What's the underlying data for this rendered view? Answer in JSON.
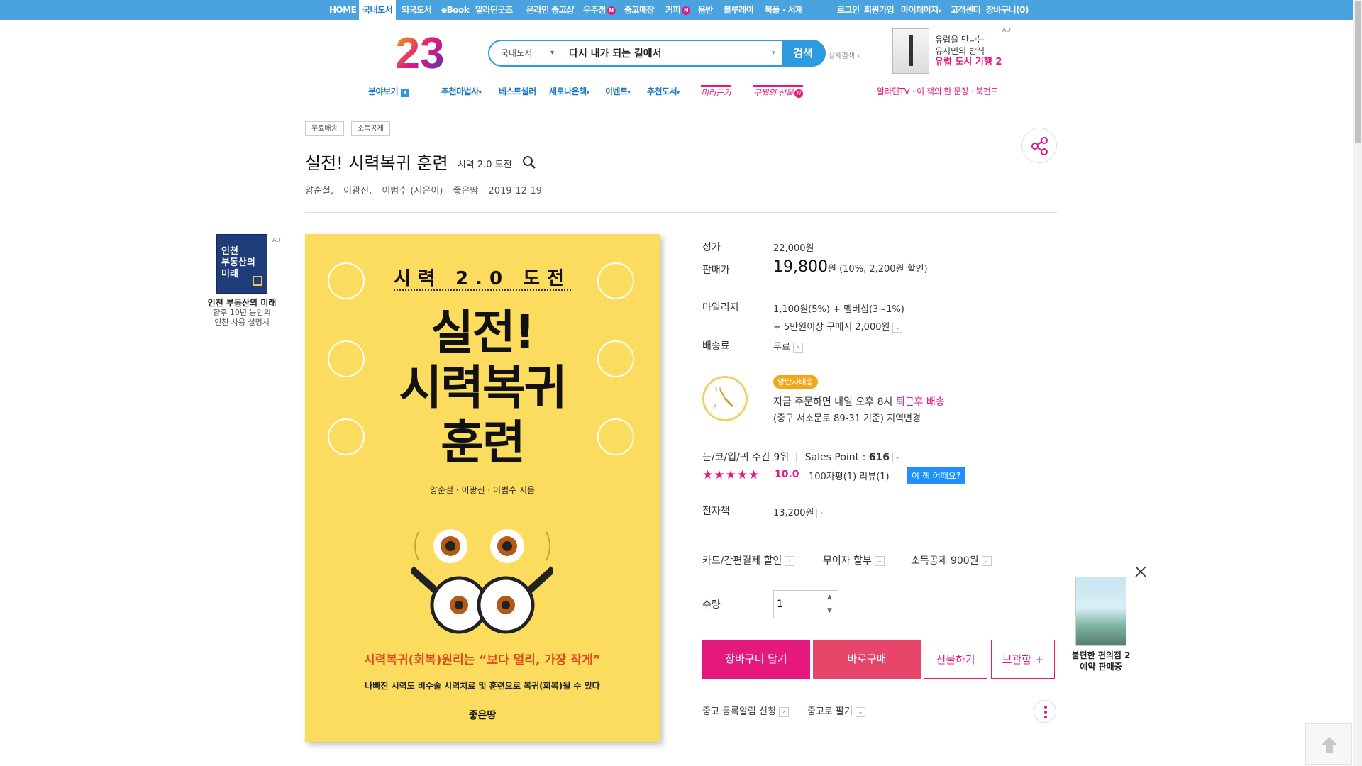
{
  "topnav": {
    "items": [
      "HOME",
      "국내도서",
      "외국도서",
      "eBook",
      "알라딘굿즈",
      "온라인 중고샵",
      "우주점",
      "중고매장",
      "커피",
      "음반",
      "블루레이",
      "북플 · 서재"
    ],
    "n_badge": "N",
    "account": [
      "로그인",
      "회원가입",
      "마이페이지",
      "고객센터",
      "장바구니(0)"
    ],
    "account_arrow": "▾"
  },
  "logo": {
    "text": "23"
  },
  "search": {
    "category": "국내도서",
    "arrow": "▾",
    "query": "다시 내가 되는 길에서",
    "button": "검색",
    "advanced": "상세검색 ›"
  },
  "top_ad": {
    "label": "AD",
    "line1": "유럽을 만나는",
    "line2": "유시민의 방식",
    "highlight": "유럽 도시 기행 2"
  },
  "subnav": {
    "category": "분야보기",
    "category_icon": "▾",
    "items": [
      "추천마법사",
      "베스트셀러",
      "새로나온책",
      "이벤트",
      "추천도서"
    ],
    "arrow": "▾",
    "image_links": [
      "미리듣기",
      "구월의 선물"
    ],
    "right": "알라딘TV · 이 책의 한 문장 · 북펀드"
  },
  "tags": [
    "무료배송",
    "소득공제"
  ],
  "book": {
    "title": "실전! 시력복귀 훈련",
    "subtitle": "- 시력 2.0 도전",
    "authors": [
      "양순철,",
      "이광진,",
      "이범수 (지은이)"
    ],
    "publisher": "좋은땅",
    "date": "2019-12-19"
  },
  "cover": {
    "series": "시력 2.0 도전",
    "title_line1": "실전!",
    "title_line2": "시력복귀",
    "title_line3": "훈련",
    "authors": "양순철 · 이광진 · 이범수 지음",
    "tagline": "시력복귀(회복)원리는 “보다 멀리, 가장 작게”",
    "description": "나빠진 시력도 비수술 시력치료 및 훈련으로 복귀(회복)될 수 있다",
    "publisher": "좋은땅"
  },
  "left_ad": {
    "label": "AD",
    "cover_text": "인천\n부동산의\n미래",
    "title": "인천 부동산의 미래",
    "desc1": "향후 10년 동안의",
    "desc2": "인천 사용 설명서"
  },
  "info": {
    "list_price_label": "정가",
    "list_price": "22,000원",
    "sale_price_label": "판매가",
    "sale_price": "19,800",
    "sale_price_unit": "원",
    "discount": "(10%, 2,200원 할인)",
    "mileage_label": "마일리지",
    "mileage_line1": "1,100원(5%) + 멤버십(3~1%)",
    "mileage_line2": "+ 5만원이상 구매시 2,000원",
    "shipping_label": "배송료",
    "shipping": "무료",
    "delivery_badge": "양탄자배송",
    "delivery_line1_a": "지금 주문하면 내일 오후 8시",
    "delivery_line1_b": "퇴근후 배송",
    "delivery_line2": "(중구 서소문로 89-31 기준) 지역변경",
    "clock_label": "퇴근",
    "rank": "눈/코/입/귀 주간 9위",
    "sales_point_label": "Sales Point :",
    "sales_point": "616",
    "stars": "★★★★★",
    "rating": "10.0",
    "rating_info": "100자평(1)   리뷰(1)",
    "how_button": "이 책 어때요?",
    "ebook_label": "전자책",
    "ebook_price": "13,200원",
    "card_discount": "카드/간편결제 할인",
    "installment": "무이자 할부",
    "tax_deduction": "소득공제 900원",
    "qty_label": "수량",
    "qty": "1",
    "used_alert": "중고 등록알림 신청",
    "sell_used": "중고로 팔기"
  },
  "buttons": {
    "cart": "장바구니 담기",
    "buy": "바로구매",
    "gift": "선물하기",
    "keep": "보관함 +"
  },
  "float_ad": {
    "title1": "불편한 편의점 2",
    "title2": "예약 판매중"
  },
  "icons": {
    "share": "share-icon",
    "search": "magnifier-icon",
    "close": "close-icon",
    "to_top": "arrow-up-icon",
    "more": "kebab-icon"
  }
}
